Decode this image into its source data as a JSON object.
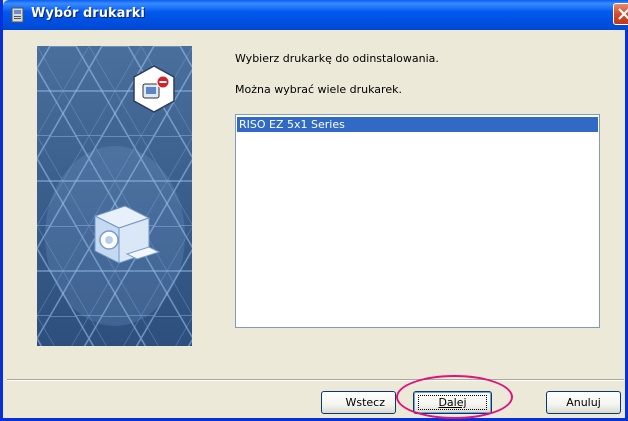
{
  "window": {
    "title": "Wybór drukarki"
  },
  "main": {
    "prompt": "Wybierz drukarkę do odinstalowania.",
    "hint": "Można wybrać wiele drukarek.",
    "printers": [
      {
        "name": "RISO EZ 5x1 Series",
        "selected": true
      }
    ]
  },
  "buttons": {
    "back": "Wstecz",
    "next": "Dalej",
    "cancel": "Anuluj"
  },
  "colors": {
    "titlebar": "#0054e3",
    "selection": "#316ac5",
    "highlight_ring": "#e0127f"
  }
}
